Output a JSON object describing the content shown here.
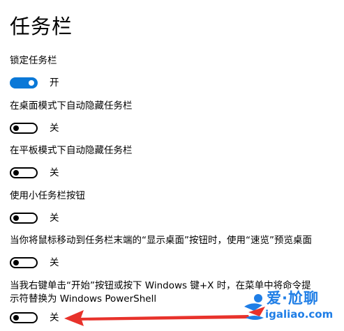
{
  "page": {
    "title": "任务栏"
  },
  "settings": [
    {
      "label": "锁定任务栏",
      "state": "开",
      "on": true
    },
    {
      "label": "在桌面模式下自动隐藏任务栏",
      "state": "关",
      "on": false
    },
    {
      "label": "在平板模式下自动隐藏任务栏",
      "state": "关",
      "on": false
    },
    {
      "label": "使用小任务栏按钮",
      "state": "关",
      "on": false
    },
    {
      "label": "当你将鼠标移动到任务栏末端的“显示桌面”按钮时，使用“速览”预览桌面",
      "state": "关",
      "on": false
    },
    {
      "label": "当我右键单击“开始”按钮或按下 Windows 键+X 时，在菜单中将命令提示符替换为 Windows PowerShell",
      "state": "关",
      "on": false
    }
  ],
  "annotation": {
    "arrow_color": "#e8322b"
  },
  "watermark": {
    "brand": "爱·尬聊",
    "url": "igaliao.com",
    "color": "#1f7ee6",
    "accent_color": "#e8322b"
  },
  "colors": {
    "accent": "#0a78d7",
    "toggle_off_border": "#000000",
    "background": "#ffffff"
  }
}
